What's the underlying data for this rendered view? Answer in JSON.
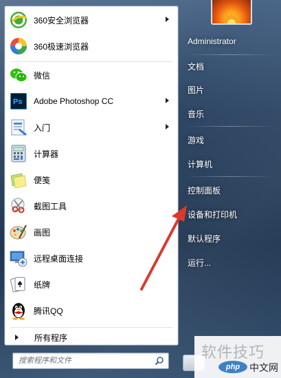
{
  "pinned": [
    {
      "label": "360安全浏览器",
      "icon": "360-secure-browser-icon",
      "submenu": true
    },
    {
      "label": "360极速浏览器",
      "icon": "360-extreme-browser-icon",
      "submenu": false
    }
  ],
  "recent": [
    {
      "label": "微信",
      "icon": "wechat-icon",
      "submenu": false
    },
    {
      "label": "Adobe Photoshop CC",
      "icon": "photoshop-icon",
      "submenu": true
    },
    {
      "label": "入门",
      "icon": "getting-started-icon",
      "submenu": true
    },
    {
      "label": "计算器",
      "icon": "calculator-icon",
      "submenu": false
    },
    {
      "label": "便笺",
      "icon": "sticky-notes-icon",
      "submenu": false
    },
    {
      "label": "截图工具",
      "icon": "snipping-tool-icon",
      "submenu": false
    },
    {
      "label": "画图",
      "icon": "paint-icon",
      "submenu": false
    },
    {
      "label": "远程桌面连接",
      "icon": "remote-desktop-icon",
      "submenu": false
    },
    {
      "label": "纸牌",
      "icon": "solitaire-icon",
      "submenu": false
    },
    {
      "label": "腾讯QQ",
      "icon": "qq-penguin-icon",
      "submenu": false
    }
  ],
  "all_programs": "所有程序",
  "search": {
    "placeholder": "搜索程序和文件"
  },
  "right_menu": {
    "user": "Administrator",
    "items": [
      "文档",
      "图片",
      "音乐",
      "游戏",
      "计算机",
      "控制面板",
      "设备和打印机",
      "默认程序",
      "运行..."
    ]
  },
  "watermark": {
    "title": "软件技巧",
    "logo": "php",
    "site": "中文网"
  },
  "colors": {
    "pointer": "#d93a2b",
    "frame": "#2c4563"
  }
}
